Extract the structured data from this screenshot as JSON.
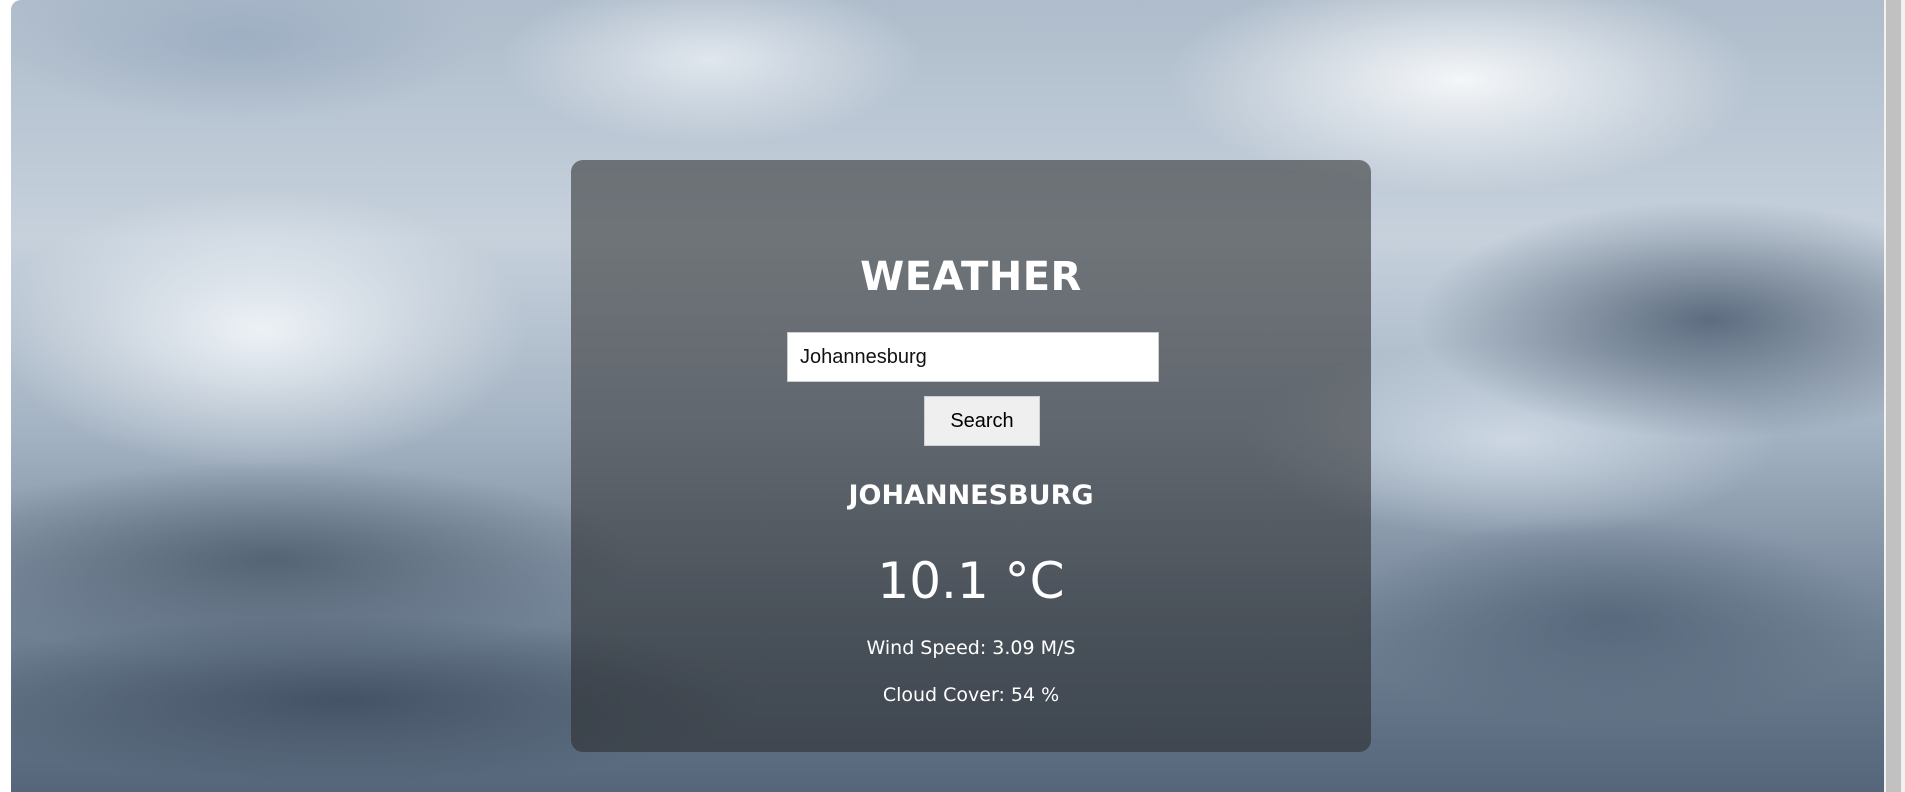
{
  "app": {
    "title": "WEATHER"
  },
  "search": {
    "value": "Johannesburg",
    "button_label": "Search"
  },
  "result": {
    "city": "JOHANNESBURG",
    "temperature": "10.1 °C",
    "wind_speed": "Wind Speed: 3.09 M/S",
    "cloud_cover": "Cloud Cover: 54 %"
  }
}
